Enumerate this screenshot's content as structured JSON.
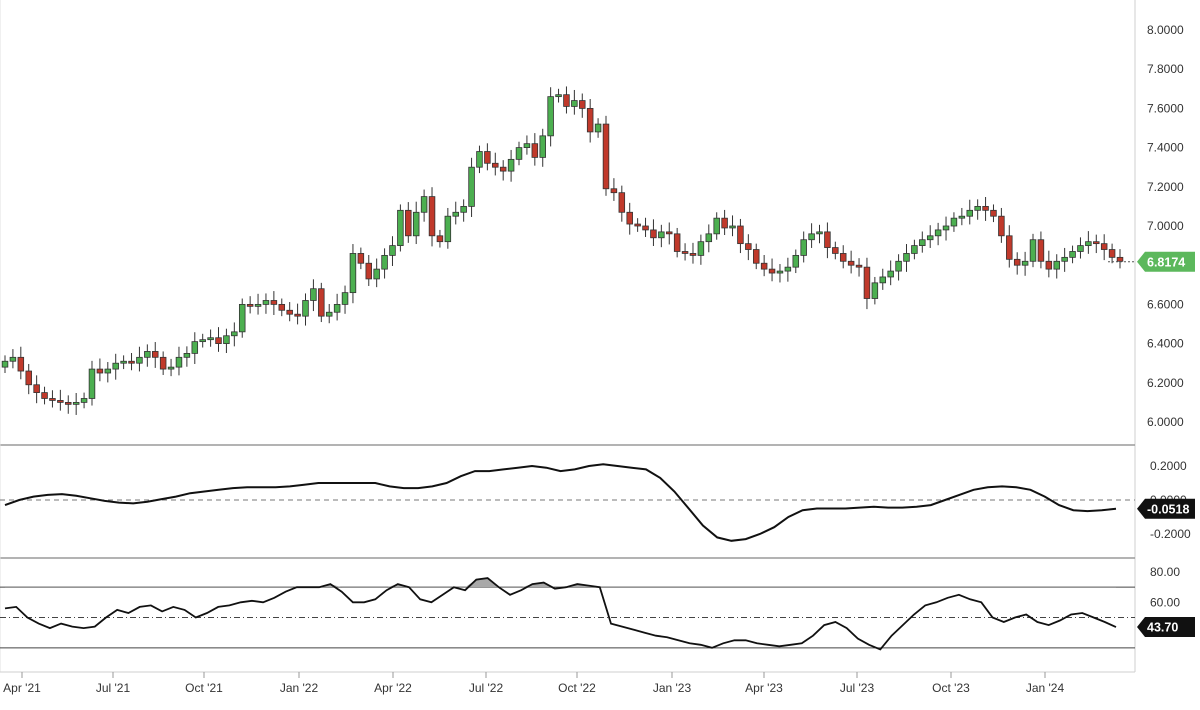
{
  "chart_data": [
    {
      "type": "candlestick",
      "interval": "weekly",
      "ylim": [
        5.95,
        8.05
      ],
      "y_ticks": [
        "6.0000",
        "6.2000",
        "6.4000",
        "6.6000",
        "6.8000",
        "7.0000",
        "7.2000",
        "7.4000",
        "7.6000",
        "7.8000",
        "8.0000"
      ],
      "x_tick_labels": [
        "Apr '21",
        "Jul '21",
        "Oct '21",
        "Jan '22",
        "Apr '22",
        "Jul '22",
        "Oct '22",
        "Jan '23",
        "Apr '23",
        "Jul '23",
        "Oct '23",
        "Jan '24"
      ],
      "last_value": 6.8174,
      "last_value_label": "6.8174",
      "up_color": "#4caf50",
      "down_color": "#c0392b",
      "badge_color": "#5cb85c",
      "close_series": [
        6.31,
        6.33,
        6.26,
        6.19,
        6.15,
        6.12,
        6.11,
        6.1,
        6.09,
        6.1,
        6.12,
        6.27,
        6.25,
        6.27,
        6.3,
        6.31,
        6.3,
        6.33,
        6.36,
        6.33,
        6.27,
        6.28,
        6.33,
        6.35,
        6.41,
        6.42,
        6.43,
        6.4,
        6.44,
        6.46,
        6.6,
        6.59,
        6.6,
        6.62,
        6.6,
        6.57,
        6.55,
        6.54,
        6.62,
        6.68,
        6.54,
        6.56,
        6.6,
        6.66,
        6.86,
        6.81,
        6.73,
        6.78,
        6.85,
        6.9,
        7.08,
        6.95,
        7.07,
        7.15,
        6.95,
        6.92,
        7.05,
        7.07,
        7.1,
        7.3,
        7.38,
        7.32,
        7.3,
        7.28,
        7.34,
        7.4,
        7.42,
        7.35,
        7.46,
        7.66,
        7.67,
        7.61,
        7.64,
        7.6,
        7.48,
        7.52,
        7.19,
        7.17,
        7.07,
        7.01,
        7.0,
        6.98,
        6.94,
        6.97,
        6.96,
        6.87,
        6.86,
        6.85,
        6.92,
        6.96,
        7.04,
        6.99,
        7.0,
        6.91,
        6.88,
        6.81,
        6.78,
        6.76,
        6.77,
        6.79,
        6.85,
        6.93,
        6.96,
        6.97,
        6.89,
        6.86,
        6.82,
        6.8,
        6.79,
        6.63,
        6.71,
        6.74,
        6.77,
        6.82,
        6.86,
        6.9,
        6.93,
        6.95,
        6.98,
        7.0,
        7.04,
        7.05,
        7.08,
        7.1,
        7.08,
        7.05,
        6.95,
        6.83,
        6.8,
        6.82,
        6.93,
        6.82,
        6.78,
        6.82,
        6.84,
        6.87,
        6.9,
        6.92,
        6.91,
        6.88,
        6.84,
        6.82
      ]
    },
    {
      "type": "line",
      "interval": "weekly",
      "ylim": [
        -0.3,
        0.28
      ],
      "y_ticks": [
        "0.2000",
        "0.0000",
        "-0.2000"
      ],
      "zero_line": true,
      "last_value": -0.0518,
      "last_value_label": "-0.0518",
      "line_color": "#111111",
      "badge_color": "#111111",
      "values": [
        -0.03,
        0.0,
        0.02,
        0.03,
        0.035,
        0.025,
        0.01,
        -0.005,
        -0.015,
        -0.02,
        -0.01,
        0.005,
        0.02,
        0.04,
        0.05,
        0.06,
        0.07,
        0.075,
        0.075,
        0.075,
        0.08,
        0.09,
        0.1,
        0.1,
        0.1,
        0.1,
        0.1,
        0.08,
        0.07,
        0.07,
        0.08,
        0.1,
        0.14,
        0.17,
        0.17,
        0.18,
        0.19,
        0.2,
        0.19,
        0.17,
        0.18,
        0.2,
        0.21,
        0.2,
        0.19,
        0.18,
        0.13,
        0.05,
        -0.05,
        -0.15,
        -0.22,
        -0.24,
        -0.23,
        -0.2,
        -0.16,
        -0.1,
        -0.06,
        -0.05,
        -0.05,
        -0.05,
        -0.045,
        -0.04,
        -0.045,
        -0.045,
        -0.04,
        -0.03,
        0.0,
        0.03,
        0.06,
        0.075,
        0.08,
        0.075,
        0.06,
        0.02,
        -0.03,
        -0.06,
        -0.065,
        -0.06,
        -0.0518
      ]
    },
    {
      "type": "line",
      "interval": "weekly",
      "ylim": [
        15,
        84
      ],
      "y_ticks": [
        "80.00",
        "60.00"
      ],
      "upper_band": 70,
      "lower_band": 30,
      "mid_line": 50,
      "last_value": 43.7,
      "last_value_label": "43.70",
      "line_color": "#111111",
      "fill_color": "#a9a9a9",
      "badge_color": "#111111",
      "values": [
        56,
        57,
        50,
        46,
        43,
        46,
        44,
        43,
        44,
        50,
        55,
        53,
        57,
        58,
        54,
        57,
        55,
        50,
        53,
        57,
        58,
        60,
        61,
        60,
        63,
        67,
        70,
        70,
        70,
        72,
        67,
        60,
        60,
        62,
        68,
        72,
        70,
        62,
        60,
        65,
        70,
        68,
        75,
        76,
        70,
        65,
        68,
        72,
        73,
        69,
        70,
        72,
        71,
        70,
        46,
        44,
        42,
        40,
        38,
        37,
        35,
        33,
        32,
        30,
        33,
        35,
        35,
        33,
        32,
        31,
        32,
        33,
        38,
        45,
        47,
        43,
        36,
        32,
        29,
        38,
        45,
        52,
        58,
        60,
        63,
        65,
        62,
        60,
        50,
        47,
        50,
        52,
        47,
        45,
        48,
        52,
        53,
        50,
        47,
        43.7
      ]
    }
  ]
}
